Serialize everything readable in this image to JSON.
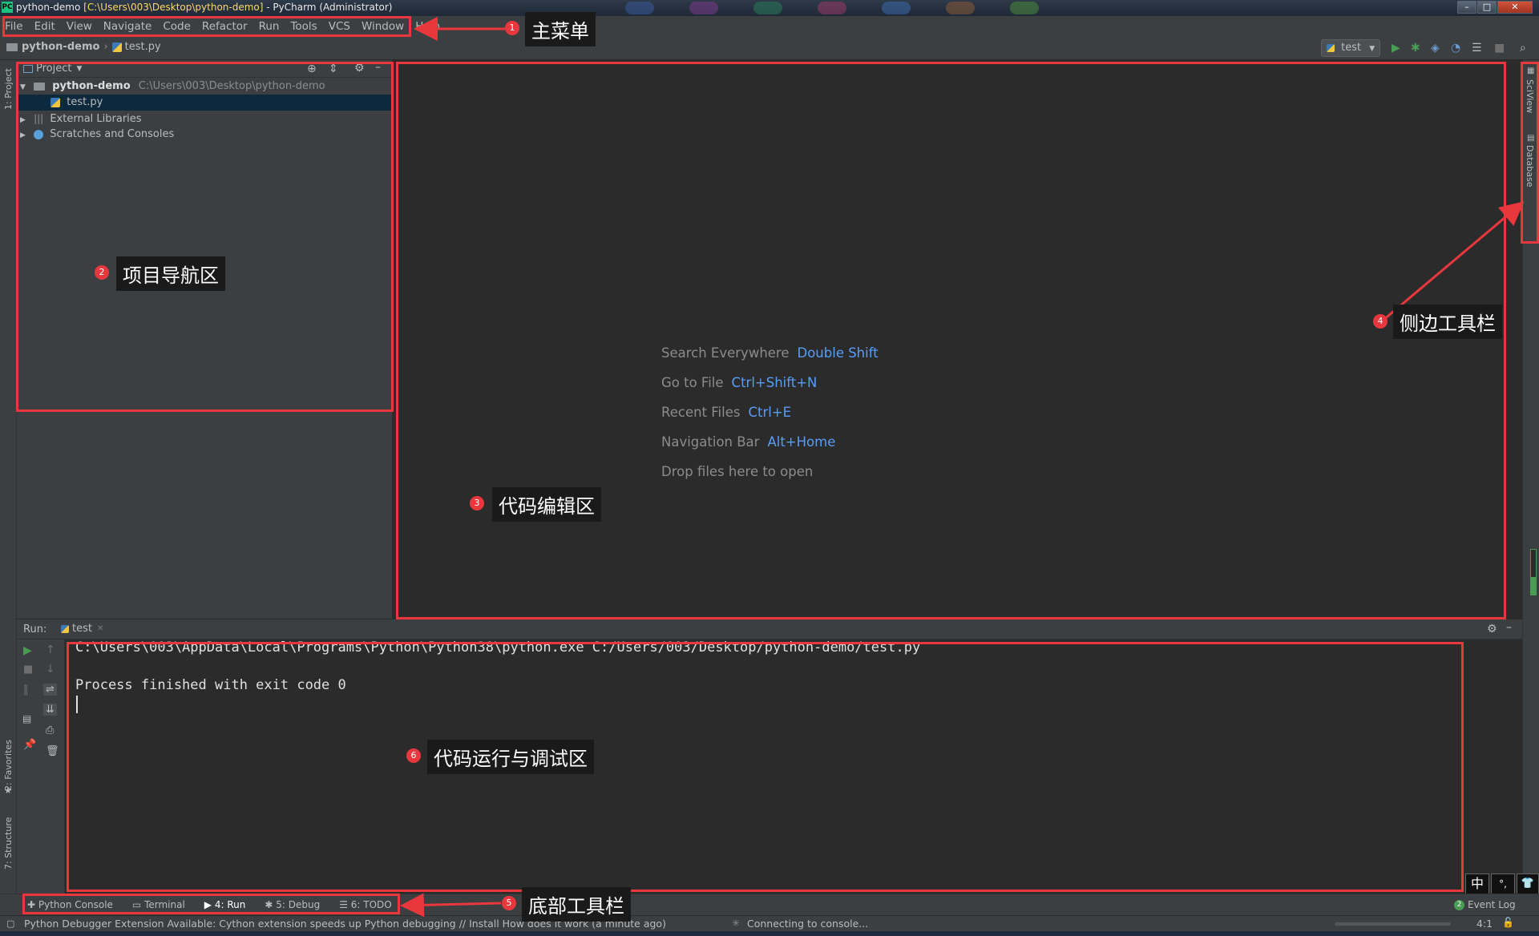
{
  "window": {
    "title_prefix": "python-demo ",
    "title_path": "[C:\\Users\\003\\Desktop\\python-demo]",
    "title_suffix": " - PyCharm (Administrator)",
    "logo": "PC"
  },
  "menu": [
    "File",
    "Edit",
    "View",
    "Navigate",
    "Code",
    "Refactor",
    "Run",
    "Tools",
    "VCS",
    "Window",
    "Help"
  ],
  "breadcrumb": {
    "project": "python-demo",
    "file": "test.py"
  },
  "toolbar": {
    "run_config": "test"
  },
  "left_stripe": {
    "project": "1: Project",
    "favorites": "2: Favorites",
    "structure": "7: Structure"
  },
  "right_stripe": {
    "sciview": "SciView",
    "database": "Database"
  },
  "project_panel": {
    "title": "Project",
    "root_name": "python-demo",
    "root_path": "C:\\Users\\003\\Desktop\\python-demo",
    "file": "test.py",
    "external": "External Libraries",
    "scratches": "Scratches and Consoles"
  },
  "editor_hints": [
    {
      "label": "Search Everywhere",
      "key": "Double Shift"
    },
    {
      "label": "Go to File",
      "key": "Ctrl+Shift+N"
    },
    {
      "label": "Recent Files",
      "key": "Ctrl+E"
    },
    {
      "label": "Navigation Bar",
      "key": "Alt+Home"
    },
    {
      "label": "Drop files here to open",
      "key": ""
    }
  ],
  "run_panel": {
    "label": "Run:",
    "tab": "test",
    "line1": "C:\\Users\\003\\AppData\\Local\\Programs\\Python\\Python38\\python.exe C:/Users/003/Desktop/python-demo/test.py",
    "line2": "Process finished with exit code 0"
  },
  "bottom_tabs": [
    "Python Console",
    "Terminal",
    "4: Run",
    "5: Debug",
    "6: TODO"
  ],
  "event_log": {
    "count": "2",
    "label": "Event Log"
  },
  "status": {
    "message": "Python Debugger Extension Available: Cython extension speeds up Python debugging // Install How does it work (a minute ago)",
    "task": "Connecting to console...",
    "position": "4:1"
  },
  "ime": [
    "中",
    "°,",
    "👕"
  ],
  "annotations": [
    {
      "num": "1",
      "text": "主菜单"
    },
    {
      "num": "2",
      "text": "项目导航区"
    },
    {
      "num": "3",
      "text": "代码编辑区"
    },
    {
      "num": "4",
      "text": "侧边工具栏"
    },
    {
      "num": "5",
      "text": "底部工具栏"
    },
    {
      "num": "6",
      "text": "代码运行与调试区"
    }
  ],
  "colors": {
    "accent_red": "#e8383d",
    "link_blue": "#589df6",
    "background": "#2b2b2b",
    "panel": "#3c3f41"
  }
}
